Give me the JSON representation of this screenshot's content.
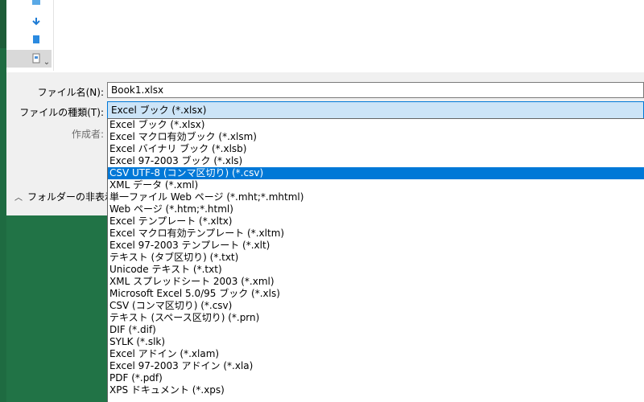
{
  "dialog": {
    "filename_label": "ファイル名(N):",
    "filename_value": "Book1.xlsx",
    "filetype_label": "ファイルの種類(T):",
    "filetype_value": "Excel ブック (*.xlsx)",
    "author_label": "作成者:",
    "hide_folders_label": "フォルダーの非表示"
  },
  "dropdown": {
    "selected_index": 4,
    "options": [
      "Excel ブック (*.xlsx)",
      "Excel マクロ有効ブック (*.xlsm)",
      "Excel バイナリ ブック (*.xlsb)",
      "Excel 97-2003 ブック (*.xls)",
      "CSV UTF-8 (コンマ区切り) (*.csv)",
      "XML データ (*.xml)",
      "単一ファイル Web ページ (*.mht;*.mhtml)",
      "Web ページ (*.htm;*.html)",
      "Excel テンプレート (*.xltx)",
      "Excel マクロ有効テンプレート (*.xltm)",
      "Excel 97-2003 テンプレート (*.xlt)",
      "テキスト (タブ区切り) (*.txt)",
      "Unicode テキスト (*.txt)",
      "XML スプレッドシート 2003 (*.xml)",
      "Microsoft Excel 5.0/95 ブック (*.xls)",
      "CSV (コンマ区切り) (*.csv)",
      "テキスト (スペース区切り) (*.prn)",
      "DIF (*.dif)",
      "SYLK (*.slk)",
      "Excel アドイン (*.xlam)",
      "Excel 97-2003 アドイン (*.xla)",
      "PDF (*.pdf)",
      "XPS ドキュメント (*.xps)"
    ]
  },
  "icons": {
    "folder_toggle": "chevron-up-icon",
    "scroll_down": "chevron-down-icon"
  },
  "colors": {
    "background": "#217346",
    "selection": "#0078d7",
    "combo_focus": "#cce4f7"
  }
}
